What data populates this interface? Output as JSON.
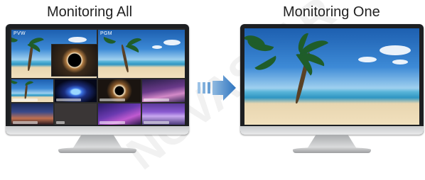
{
  "left_caption": "Monitoring All",
  "right_caption": "Monitoring One",
  "pvw_label": "PVW",
  "pgm_label": "PGM",
  "watermark_text": "NOVASTAR"
}
